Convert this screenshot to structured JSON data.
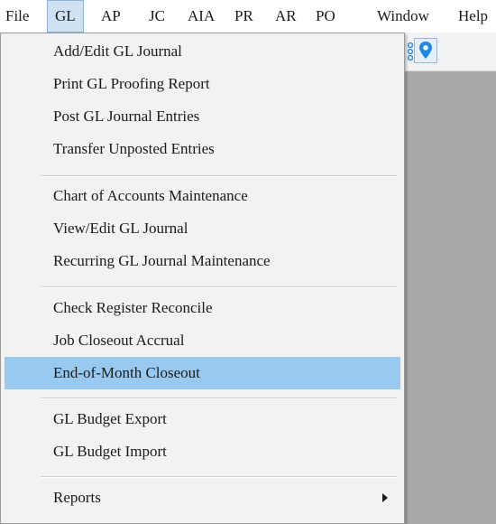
{
  "menubar": {
    "items": [
      "File",
      "GL",
      "AP",
      "JC",
      "AIA",
      "PR",
      "AR",
      "PO",
      "Window",
      "Help"
    ],
    "active": "GL"
  },
  "gl_menu": {
    "items": [
      {
        "label": "Add/Edit GL Journal"
      },
      {
        "label": "Print GL Proofing Report"
      },
      {
        "label": "Post GL Journal Entries"
      },
      {
        "label": "Transfer Unposted Entries"
      },
      {
        "label": "Chart of Accounts Maintenance"
      },
      {
        "label": "View/Edit GL Journal"
      },
      {
        "label": "Recurring GL Journal Maintenance"
      },
      {
        "label": "Check Register Reconcile"
      },
      {
        "label": "Job Closeout Accrual"
      },
      {
        "label": "End-of-Month Closeout",
        "highlighted": true
      },
      {
        "label": "GL Budget Export"
      },
      {
        "label": "GL Budget Import"
      },
      {
        "label": "Reports",
        "submenu": true
      }
    ]
  },
  "toolbar": {
    "icons": [
      "toolbar-dots-icon",
      "location-pin-icon"
    ]
  },
  "colors": {
    "menu_highlight": "#99c9f0",
    "active_menubar": "#cfe2f3",
    "workspace": "#a9a9a9",
    "pin_icon": "#1e88e5"
  }
}
